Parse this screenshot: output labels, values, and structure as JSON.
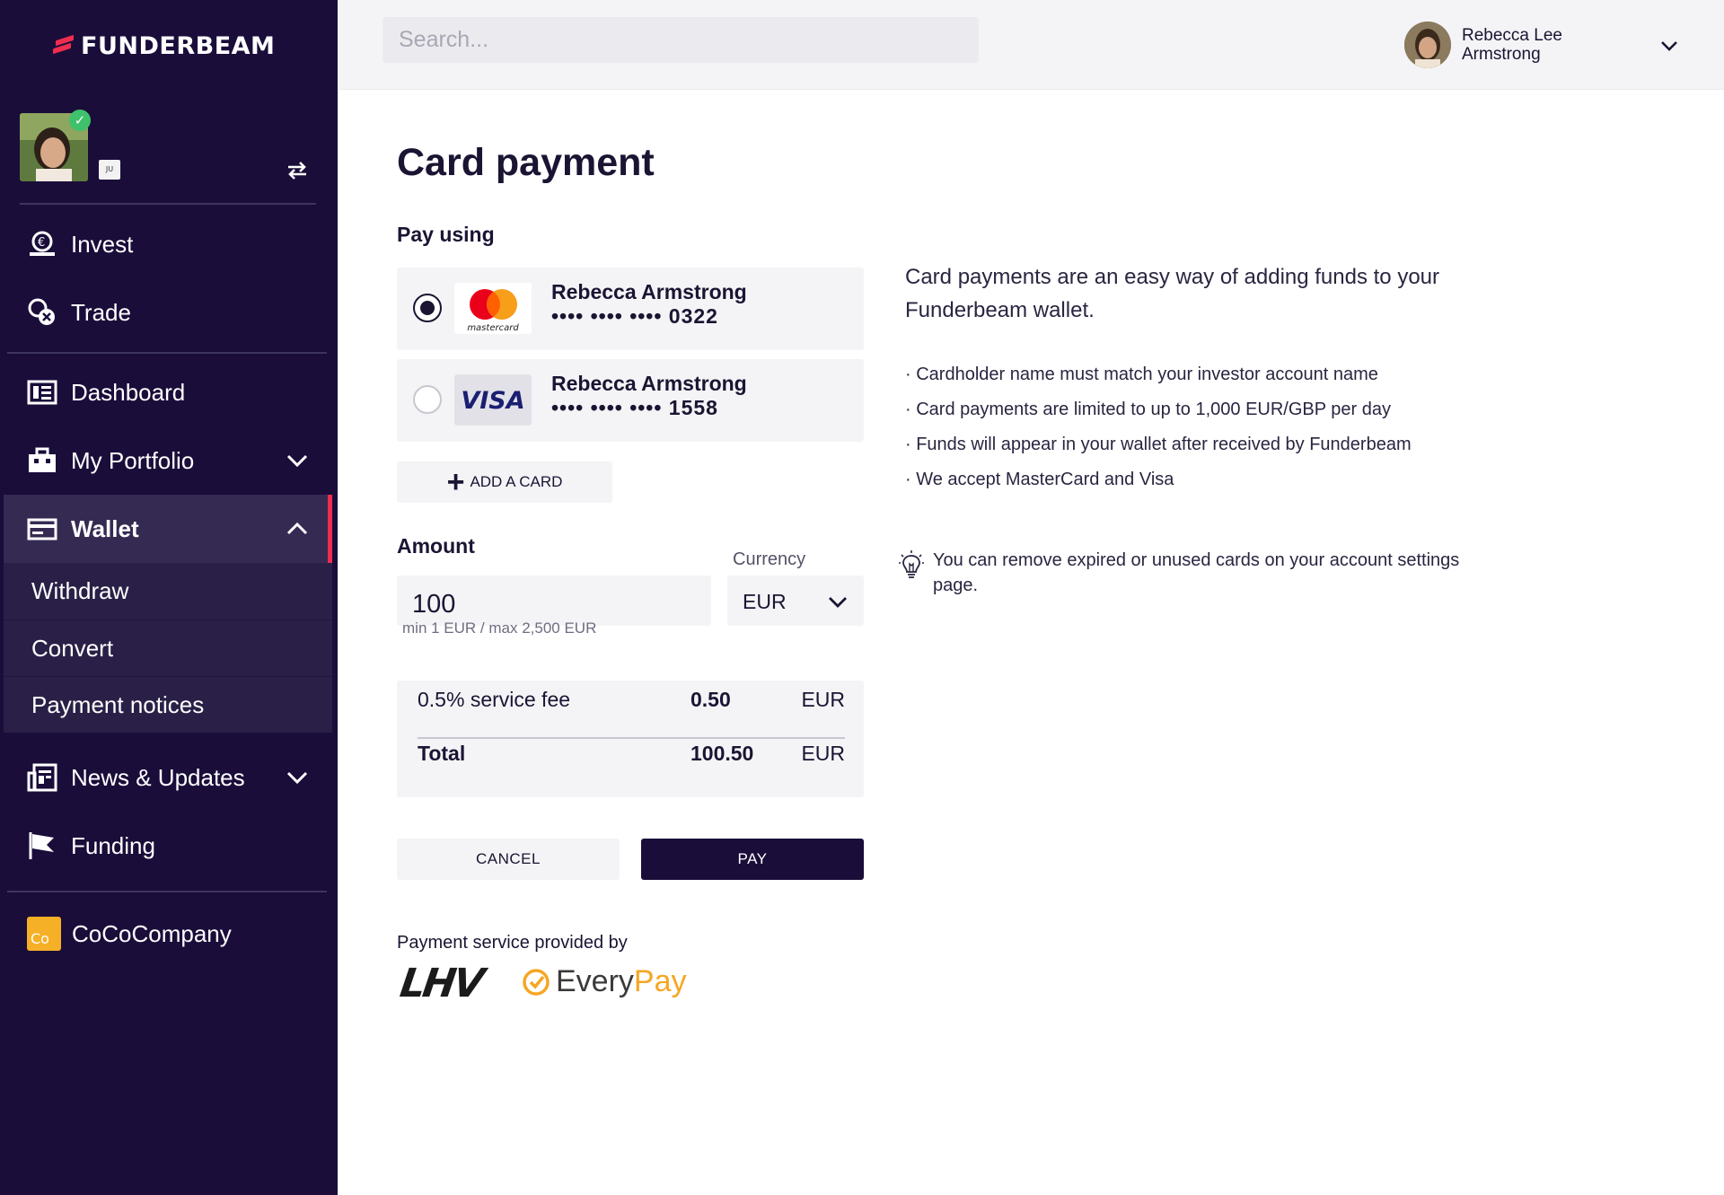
{
  "brand": {
    "name": "FUNDERBEAM"
  },
  "profile": {
    "badge": "JU"
  },
  "nav": {
    "invest": "Invest",
    "trade": "Trade",
    "dashboard": "Dashboard",
    "my_portfolio": "My Portfolio",
    "wallet": "Wallet",
    "wallet_sub": [
      "Withdraw",
      "Convert",
      "Payment notices"
    ],
    "news": "News & Updates",
    "funding": "Funding",
    "company": "CoCoCompany",
    "company_logo_text": "Co"
  },
  "search": {
    "placeholder": "Search..."
  },
  "user": {
    "name_line1": "Rebecca Lee",
    "name_line2": "Armstrong"
  },
  "page": {
    "title": "Card payment",
    "pay_using_label": "Pay using",
    "cards": [
      {
        "brand": "mastercard",
        "holder": "Rebecca Armstrong",
        "number": "•••• •••• •••• 0322",
        "selected": true
      },
      {
        "brand": "VISA",
        "holder": "Rebecca Armstrong",
        "number": "•••• •••• •••• 1558",
        "selected": false
      }
    ],
    "add_card_label": "ADD A CARD",
    "amount_label": "Amount",
    "amount_value": "100",
    "amount_hint": "min 1 EUR / max 2,500 EUR",
    "currency_label": "Currency",
    "currency_value": "EUR",
    "fee": {
      "label": "0.5% service fee",
      "value": "0.50",
      "currency": "EUR"
    },
    "total": {
      "label": "Total",
      "value": "100.50",
      "currency": "EUR"
    },
    "cancel_label": "CANCEL",
    "pay_label": "PAY",
    "provider_text": "Payment service provided by",
    "provider_logos": {
      "lhv": "LHV",
      "everypay_every": "Every",
      "everypay_pay": "Pay"
    }
  },
  "info": {
    "intro": "Card payments are an easy way of adding funds to your Funderbeam wallet.",
    "bullets": [
      "Cardholder name must match your investor account name",
      "Card payments are limited to up to 1,000 EUR/GBP per day",
      "Funds will appear in your wallet after received by Funderbeam",
      "We accept MasterCard and Visa"
    ],
    "tip": "You can remove expired or unused cards on your account settings page."
  },
  "colors": {
    "sidebar_bg": "#1a0d3a",
    "accent": "#ef2d4e",
    "primary_button": "#1a0d3a"
  }
}
